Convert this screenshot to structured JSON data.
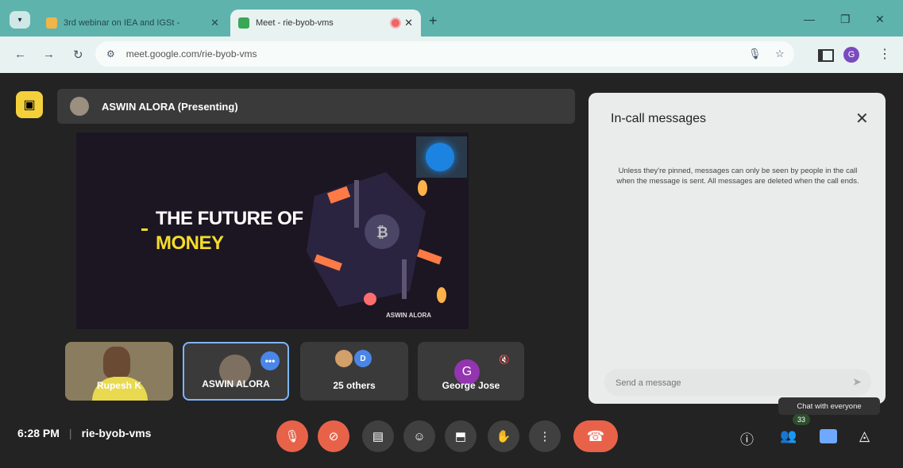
{
  "browser": {
    "tabs": [
      {
        "title": "3rd webinar on IEA and IGSt - ",
        "active": false
      },
      {
        "title": "Meet - rie-byob-vms",
        "active": true
      }
    ],
    "url": "meet.google.com/rie-byob-vms",
    "profile_initial": "G"
  },
  "meet": {
    "presenter_label": "ASWIN ALORA (Presenting)",
    "slide": {
      "line1": "THE FUTURE OF",
      "line2": "MONEY",
      "footer": "ASWIN ALORA"
    },
    "tiles": [
      {
        "name": "Rupesh K"
      },
      {
        "name": "ASWIN ALORA"
      },
      {
        "name": "25 others",
        "avatar_letter": "D"
      },
      {
        "name": "George Jose",
        "avatar_letter": "G"
      }
    ],
    "time": "6:28 PM",
    "meeting_code": "rie-byob-vms"
  },
  "panel": {
    "title": "In-call messages",
    "info": "Unless they're pinned, messages can only be seen by people in the call when the message is sent. All messages are deleted when the call ends.",
    "input_placeholder": "Send a message"
  },
  "tooltip": "Chat with everyone",
  "participants_count": "33",
  "colors": {
    "tab_strip": "#5fb3ad",
    "end_call": "#e8624a",
    "slide_accent": "#f5dc2a"
  }
}
